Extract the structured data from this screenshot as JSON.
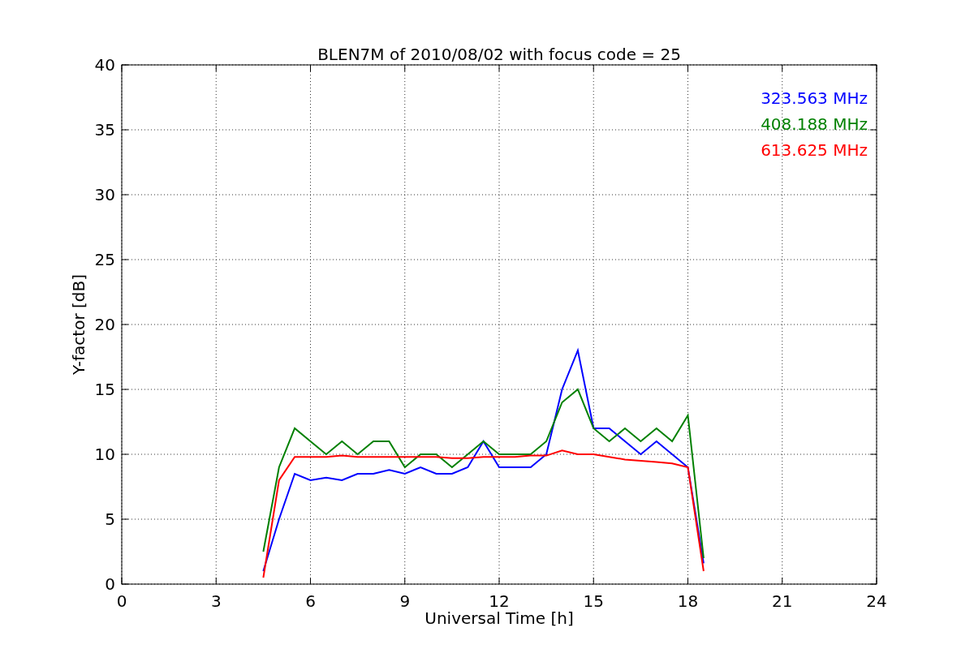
{
  "chart_data": {
    "type": "line",
    "title": "BLEN7M of 2010/08/02 with focus code = 25",
    "xlabel": "Universal Time [h]",
    "ylabel": "Y-factor [dB]",
    "x": [
      4.5,
      5,
      5.5,
      6,
      6.5,
      7,
      7.5,
      8,
      8.5,
      9,
      9.5,
      10,
      10.5,
      11,
      11.5,
      12,
      12.5,
      13,
      13.5,
      14,
      14.5,
      15,
      15.5,
      16,
      16.5,
      17,
      17.5,
      18,
      18.5
    ],
    "series": [
      {
        "name": "323.563 MHz",
        "color": "#0000ff",
        "values": [
          1,
          5,
          8.5,
          8,
          8.2,
          8,
          8.5,
          8.5,
          8.8,
          8.5,
          9,
          8.5,
          8.5,
          9,
          11,
          9,
          9,
          9,
          10,
          15,
          18,
          12,
          12,
          11,
          10,
          11,
          10,
          9,
          1.6
        ]
      },
      {
        "name": "408.188 MHz",
        "color": "#008000",
        "values": [
          2.5,
          9,
          12,
          11,
          10,
          11,
          10,
          11,
          11,
          9,
          10,
          10,
          9,
          10,
          11,
          10,
          10,
          10,
          11,
          14,
          15,
          12,
          11,
          12,
          11,
          12,
          11,
          13,
          2
        ]
      },
      {
        "name": "613.625 MHz",
        "color": "#ff0000",
        "values": [
          0.5,
          8,
          9.8,
          9.8,
          9.8,
          9.9,
          9.8,
          9.8,
          9.8,
          9.8,
          9.8,
          9.8,
          9.7,
          9.7,
          9.8,
          9.8,
          9.8,
          9.9,
          9.9,
          10.3,
          10,
          10,
          9.8,
          9.6,
          9.5,
          9.4,
          9.3,
          9,
          1
        ]
      }
    ],
    "xlim": [
      0,
      24
    ],
    "ylim": [
      0,
      40
    ],
    "xticks": [
      0,
      3,
      6,
      9,
      12,
      15,
      18,
      21,
      24
    ],
    "yticks": [
      0,
      5,
      10,
      15,
      20,
      25,
      30,
      35,
      40
    ],
    "grid": true
  }
}
